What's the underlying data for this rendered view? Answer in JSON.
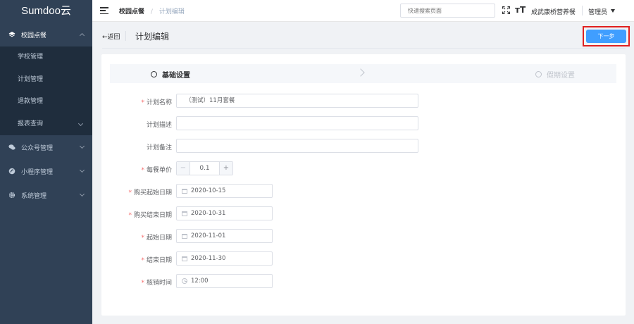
{
  "app": {
    "logo": "Sumdoo云"
  },
  "sidebar": {
    "groups": [
      {
        "label": "校园点餐",
        "icon": "layers-icon",
        "expanded": true,
        "items": [
          {
            "label": "学校管理"
          },
          {
            "label": "计划管理"
          },
          {
            "label": "退款管理"
          },
          {
            "label": "报表查询"
          }
        ]
      },
      {
        "label": "公众号管理",
        "icon": "chat-icon"
      },
      {
        "label": "小程序管理",
        "icon": "miniapp-icon"
      },
      {
        "label": "系统管理",
        "icon": "gear-icon"
      }
    ]
  },
  "header": {
    "breadcrumb": {
      "root": "校园点餐",
      "separator": "/",
      "current": "计划编辑"
    },
    "search_placeholder": "快速搜索页面",
    "store_name": "成武康桥营养餐",
    "user": "管理员"
  },
  "page": {
    "back_label": "←返回",
    "title": "计划编辑",
    "next_label": "下一步"
  },
  "steps": [
    {
      "label": "基础设置",
      "active": true
    },
    {
      "label": "假期设置",
      "active": false
    }
  ],
  "form": {
    "plan_name": {
      "label": "计划名称",
      "required": true,
      "value": "（测试）11月套餐"
    },
    "plan_desc": {
      "label": "计划描述",
      "required": false,
      "value": ""
    },
    "plan_note": {
      "label": "计划备注",
      "required": false,
      "value": ""
    },
    "unit_price": {
      "label": "每餐单价",
      "required": true,
      "value": "0.1",
      "minus": "−",
      "plus": "+"
    },
    "buy_start": {
      "label": "购买起始日期",
      "required": true,
      "value": "2020-10-15"
    },
    "buy_end": {
      "label": "购买结束日期",
      "required": true,
      "value": "2020-10-31"
    },
    "start_date": {
      "label": "起始日期",
      "required": true,
      "value": "2020-11-01"
    },
    "end_date": {
      "label": "结束日期",
      "required": true,
      "value": "2020-11-30"
    },
    "verify_time": {
      "label": "核销时间",
      "required": true,
      "value": "12:00"
    }
  },
  "colors": {
    "sidebar": "#304156",
    "submenu": "#1f2d3d",
    "primary": "#409eff",
    "highlight": "#e02020",
    "required": "#f56c6c"
  }
}
